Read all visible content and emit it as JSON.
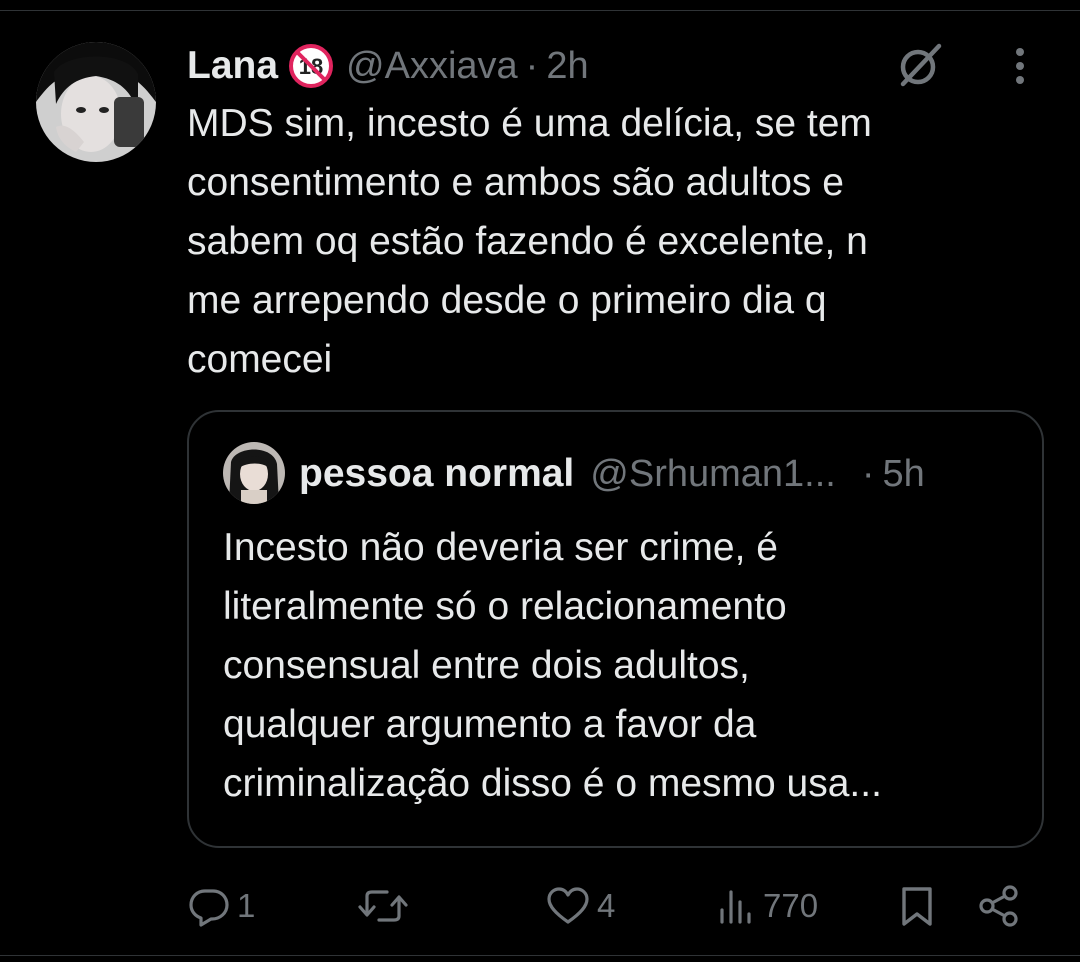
{
  "tweet": {
    "display_name": "Lana",
    "badge": "18",
    "handle": "@Axxiava",
    "separator": "·",
    "time": "2h",
    "text": "MDS sim, incesto é uma delícia, se tem\nconsentimento e ambos são adultos e\nsabem oq estão fazendo é excelente, n\nme arrependo desde o primeiro dia q\ncomecei"
  },
  "quote": {
    "display_name": "pessoa normal",
    "handle": "@Srhuman1...",
    "separator": "·",
    "time": "5h",
    "text": "Incesto não deveria ser crime, é\nliteralmente só o  relacionamento\nconsensual entre dois adultos,\nqualquer argumento a favor da\ncriminalização disso é o mesmo usa..."
  },
  "actions": {
    "replies": "1",
    "retweets": "",
    "likes": "4",
    "views": "770"
  },
  "icons": {
    "header_right": [
      "grok-icon",
      "more-icon"
    ],
    "action_bar": [
      "reply-icon",
      "retweet-icon",
      "like-icon",
      "views-icon",
      "bookmark-icon",
      "share-icon"
    ]
  },
  "colors": {
    "background": "#000000",
    "text_primary": "#e7e9ea",
    "text_secondary": "#71767b",
    "border": "#2f3336",
    "badge_red": "#e0245e"
  }
}
